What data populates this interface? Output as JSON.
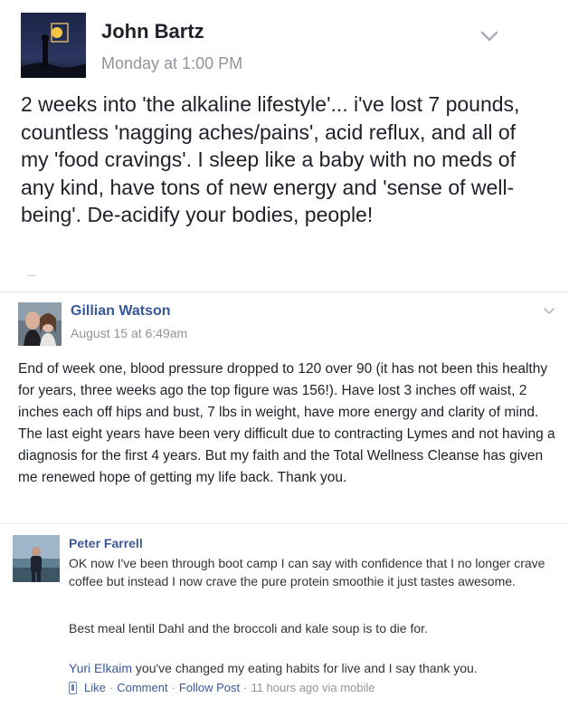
{
  "posts": [
    {
      "author": "John Bartz",
      "time": "Monday at 1:00 PM",
      "text": "2 weeks into 'the alkaline lifestyle'... i've lost 7 pounds, countless 'nagging aches/pains', acid reflux, and all of my 'food cravings'.   I sleep like a baby with no meds of any kind, have tons of new energy and 'sense of well-being'. De-acidify your bodies, people!"
    },
    {
      "author": "Gillian Watson",
      "time": "August 15 at 6:49am",
      "text": "End of week one, blood pressure dropped to 120 over 90 (it has not been this healthy for years, three weeks ago the top figure was 156!). Have lost 3 inches off waist, 2 inches each off hips and bust, 7 lbs in weight, have more energy and clarity of mind. The last eight years have been very difficult due to contracting Lymes and not having a diagnosis for the first 4 years. But my faith and the Total Wellness Cleanse has given me renewed hope of getting my life back. Thank you."
    },
    {
      "author": "Peter Farrell",
      "text": "OK now I've been through boot camp I can say with confidence that I no longer crave coffee but instead I now crave the pure protein smoothie it just tastes awesome.",
      "text2": "Best meal lentil Dahl and the broccoli and kale soup is to die for.",
      "reply": {
        "author": "Yuri Elkaim",
        "text": "you've changed my eating habits for live and I say thank you."
      },
      "actions": {
        "like": "Like",
        "comment": "Comment",
        "follow": "Follow Post",
        "meta": "11 hours ago via mobile"
      }
    }
  ]
}
